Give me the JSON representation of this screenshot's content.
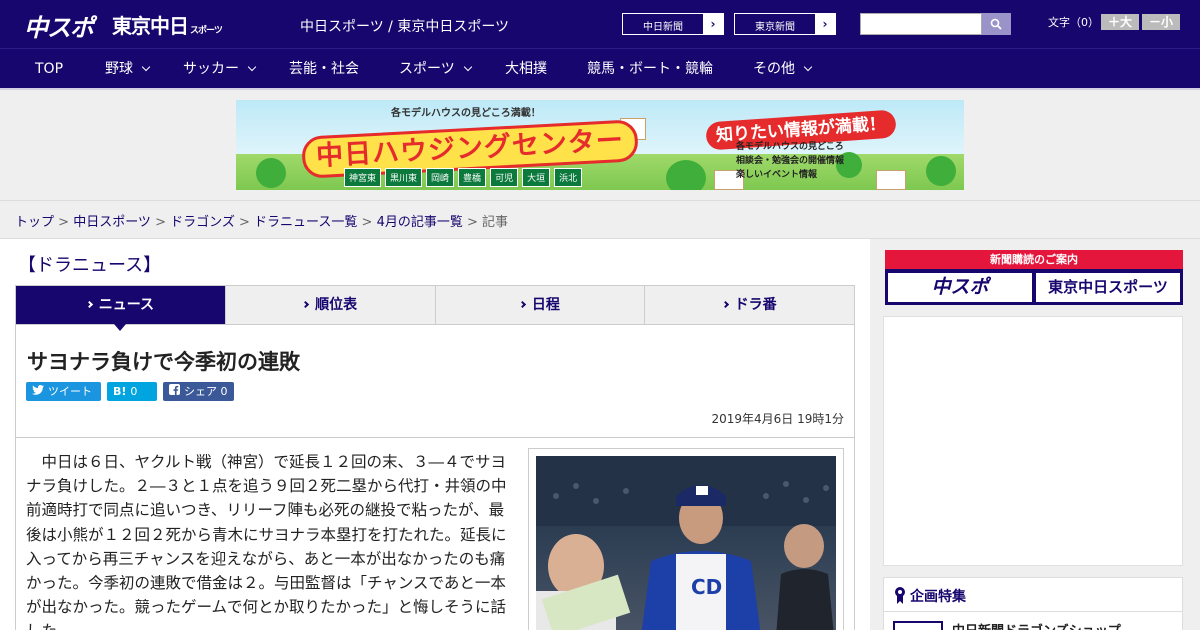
{
  "header": {
    "logo_chuspo": "中スポ",
    "logo_tokyo": "東京中日",
    "logo_tokyo_sub": "スポーツ",
    "site_title": "中日スポーツ / 東京中日スポーツ",
    "links": [
      {
        "label": "中日新聞",
        "arrow": "›"
      },
      {
        "label": "東京新聞",
        "arrow": "›"
      }
    ],
    "search_placeholder": "",
    "font_size_label": "文字（0）",
    "font_larger": "＋大",
    "font_smaller": "－小"
  },
  "nav": {
    "items": [
      {
        "label": "TOP"
      },
      {
        "label": "野球"
      },
      {
        "label": "サッカー"
      },
      {
        "label": "芸能・社会"
      },
      {
        "label": "スポーツ"
      },
      {
        "label": "大相撲"
      },
      {
        "label": "競馬・ボート・競輪"
      },
      {
        "label": "その他"
      }
    ]
  },
  "banner": {
    "top_note": "各モデルハウスの見どころ満載！",
    "title": "中日ハウジングセンター",
    "bubble": "知りたい情報が満載！",
    "info_lines": [
      "各モデルハウスの見どころ",
      "相談会・勉強会の開催情報",
      "楽しいイベント情報"
    ],
    "cities": [
      "神宮東",
      "黒川東",
      "岡崎",
      "豊橋",
      "可児",
      "大垣",
      "浜北"
    ]
  },
  "breadcrumb": {
    "items": [
      "トップ",
      "中日スポーツ",
      "ドラゴンズ",
      "ドラニュース一覧",
      "4月の記事一覧"
    ],
    "current": "記事",
    "sep": " > "
  },
  "main": {
    "section_heading": "【ドラニュース】",
    "tabs": [
      {
        "label": "ニュース"
      },
      {
        "label": "順位表"
      },
      {
        "label": "日程"
      },
      {
        "label": "ドラ番"
      }
    ],
    "article": {
      "title": "サヨナラ負けで今季初の連敗",
      "share": {
        "tweet": "ツイート",
        "hatena_count": "0",
        "fb_label": "シェア",
        "fb_count": "0"
      },
      "date": "2019年4月6日 19時1分",
      "body": "中日は６日、ヤクルト戦（神宮）で延長１２回の末、３―４でサヨナラ負けした。２―３と１点を追う９回２死二塁から代打・井領の中前適時打で同点に追いつき、リリーフ陣も必死の継投で粘ったが、最後は小熊が１２回２死から青木にサヨナラ本塁打を打たれた。延長に入ってから再三チャンスを迎えながら、あと一本が出なかったのも痛かった。今季初の連敗で借金は２。与田監督は「チャンスであと一本が出なかった。競ったゲームで何とか取りたかった」と悔しそうに話した。"
    }
  },
  "sidebar": {
    "subscribe_head": "新聞購読のご案内",
    "subscribe_logos": [
      "中スポ",
      "東京中日スポーツ"
    ],
    "feature_heading": "企画特集",
    "feature_item": "中日新聞ドラゴンズショップ"
  },
  "colors": {
    "brand_navy": "#16066e",
    "accent_red": "#e4163b",
    "twitter": "#1b95e0",
    "facebook": "#3b5998"
  }
}
